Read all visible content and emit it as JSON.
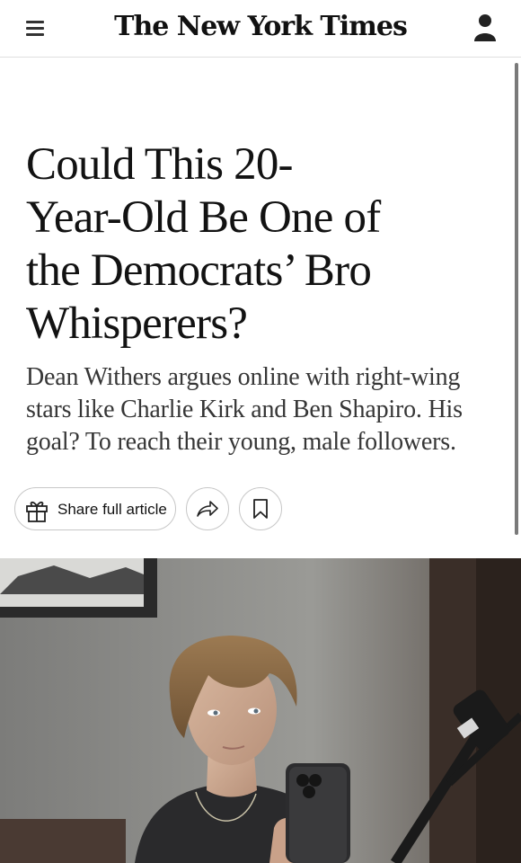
{
  "header": {
    "logo_text": "The New York Times",
    "menu_icon": "hamburger-menu-icon",
    "account_icon": "account-icon"
  },
  "article": {
    "headline": "Could This 20-Year-Old Be One of the Democrats’ Bro Whisperers?",
    "summary": "Dean Withers argues online with right-wing stars like Charlie Kirk and Ben Shapiro. His goal? To reach their young, male followers."
  },
  "actions": {
    "share_full_article_label": "Share full article",
    "gift_icon": "gift-icon",
    "share_icon": "share-arrow-icon",
    "save_icon": "bookmark-icon"
  },
  "colors": {
    "text": "#121212",
    "summary_text": "#363636",
    "border": "#c7c7c7"
  }
}
